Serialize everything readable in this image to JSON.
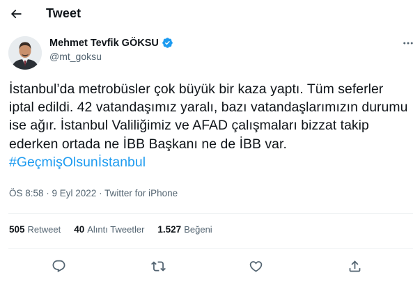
{
  "header": {
    "title": "Tweet",
    "back_icon": "arrow-left-icon"
  },
  "author": {
    "display_name": "Mehmet Tevfik GÖKSU",
    "handle": "@mt_goksu",
    "verified_icon": "verified-badge-icon",
    "more_icon": "more-horizontal-icon"
  },
  "tweet": {
    "text": "İstanbul’da metrobüsler çok büyük bir kaza yaptı. Tüm seferler iptal edildi. 42 vatandaşımız yaralı, bazı vatandaşlarımızın durumu ise ağır. İstanbul Valiliğimiz ve AFAD çalışmaları bizzat takip ederken ortada ne İBB Başkanı ne de İBB var.",
    "hashtag": "#GeçmişOlsunİstanbul"
  },
  "meta": {
    "time_date": "ÖS 8:58 · 9 Eyl 2022",
    "separator": " · ",
    "source": "Twitter for iPhone"
  },
  "stats": {
    "retweets_count": "505",
    "retweets_label": "Retweet",
    "quotes_count": "40",
    "quotes_label": "Alıntı Tweetler",
    "likes_count": "1.527",
    "likes_label": "Beğeni"
  },
  "actions": [
    "reply-icon",
    "retweet-icon",
    "like-icon",
    "share-icon"
  ],
  "colors": {
    "accent": "#1d9bf0",
    "text_primary": "#0f1419",
    "text_secondary": "#536471",
    "divider": "#eff3f4"
  }
}
